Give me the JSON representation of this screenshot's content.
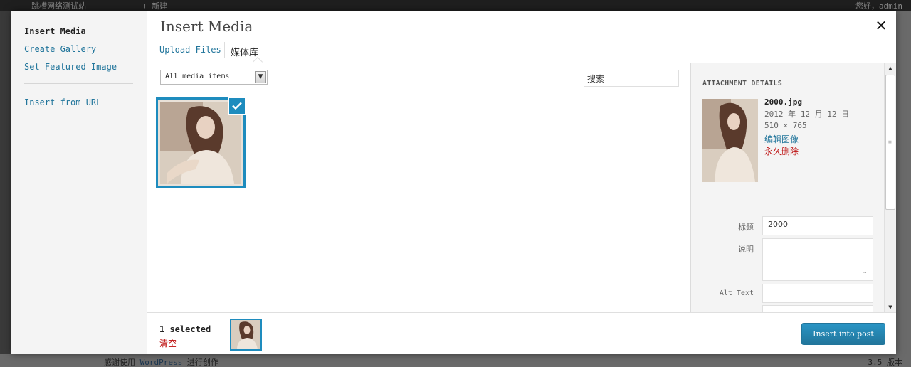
{
  "modal": {
    "title": "Insert Media",
    "close_icon": "close-icon"
  },
  "menu": {
    "items": [
      {
        "label": "Insert Media",
        "active": true
      },
      {
        "label": "Create Gallery"
      },
      {
        "label": "Set Featured Image"
      },
      {
        "label": "Insert from URL"
      }
    ]
  },
  "router": {
    "tabs": [
      {
        "label": "Upload Files"
      },
      {
        "label": "媒体库",
        "active": true
      }
    ]
  },
  "toolbar": {
    "filter_selected": "All media items",
    "search_value": "搜索"
  },
  "attachments": [
    {
      "name": "2000.jpg",
      "selected": true
    }
  ],
  "details": {
    "heading": "ATTACHMENT DETAILS",
    "filename": "2000.jpg",
    "date": "2012 年 12 月 12 日",
    "dimensions": "510 × 765",
    "edit_link": "编辑图像",
    "delete_link": "永久删除",
    "fields": {
      "title": {
        "label": "标题",
        "value": "2000"
      },
      "caption": {
        "label": "说明",
        "value": ""
      },
      "alt": {
        "label": "Alt Text",
        "value": ""
      },
      "description": {
        "label": "描述",
        "value": ""
      }
    }
  },
  "selection": {
    "count_label": "1 selected",
    "clear_label": "清空"
  },
  "buttons": {
    "insert": "Insert into post"
  },
  "background": {
    "site_name": "跳槽网络测试站",
    "new_label": "+ 新建",
    "user_label": "您好，admin",
    "footer_thanks_pre": "感谢使用",
    "footer_thanks_wp": "WordPress",
    "footer_thanks_post": "进行创作",
    "version": "3.5 版本"
  },
  "colors": {
    "accent": "#1e8cbe",
    "link": "#21759b",
    "delete": "#bc0b0b"
  }
}
